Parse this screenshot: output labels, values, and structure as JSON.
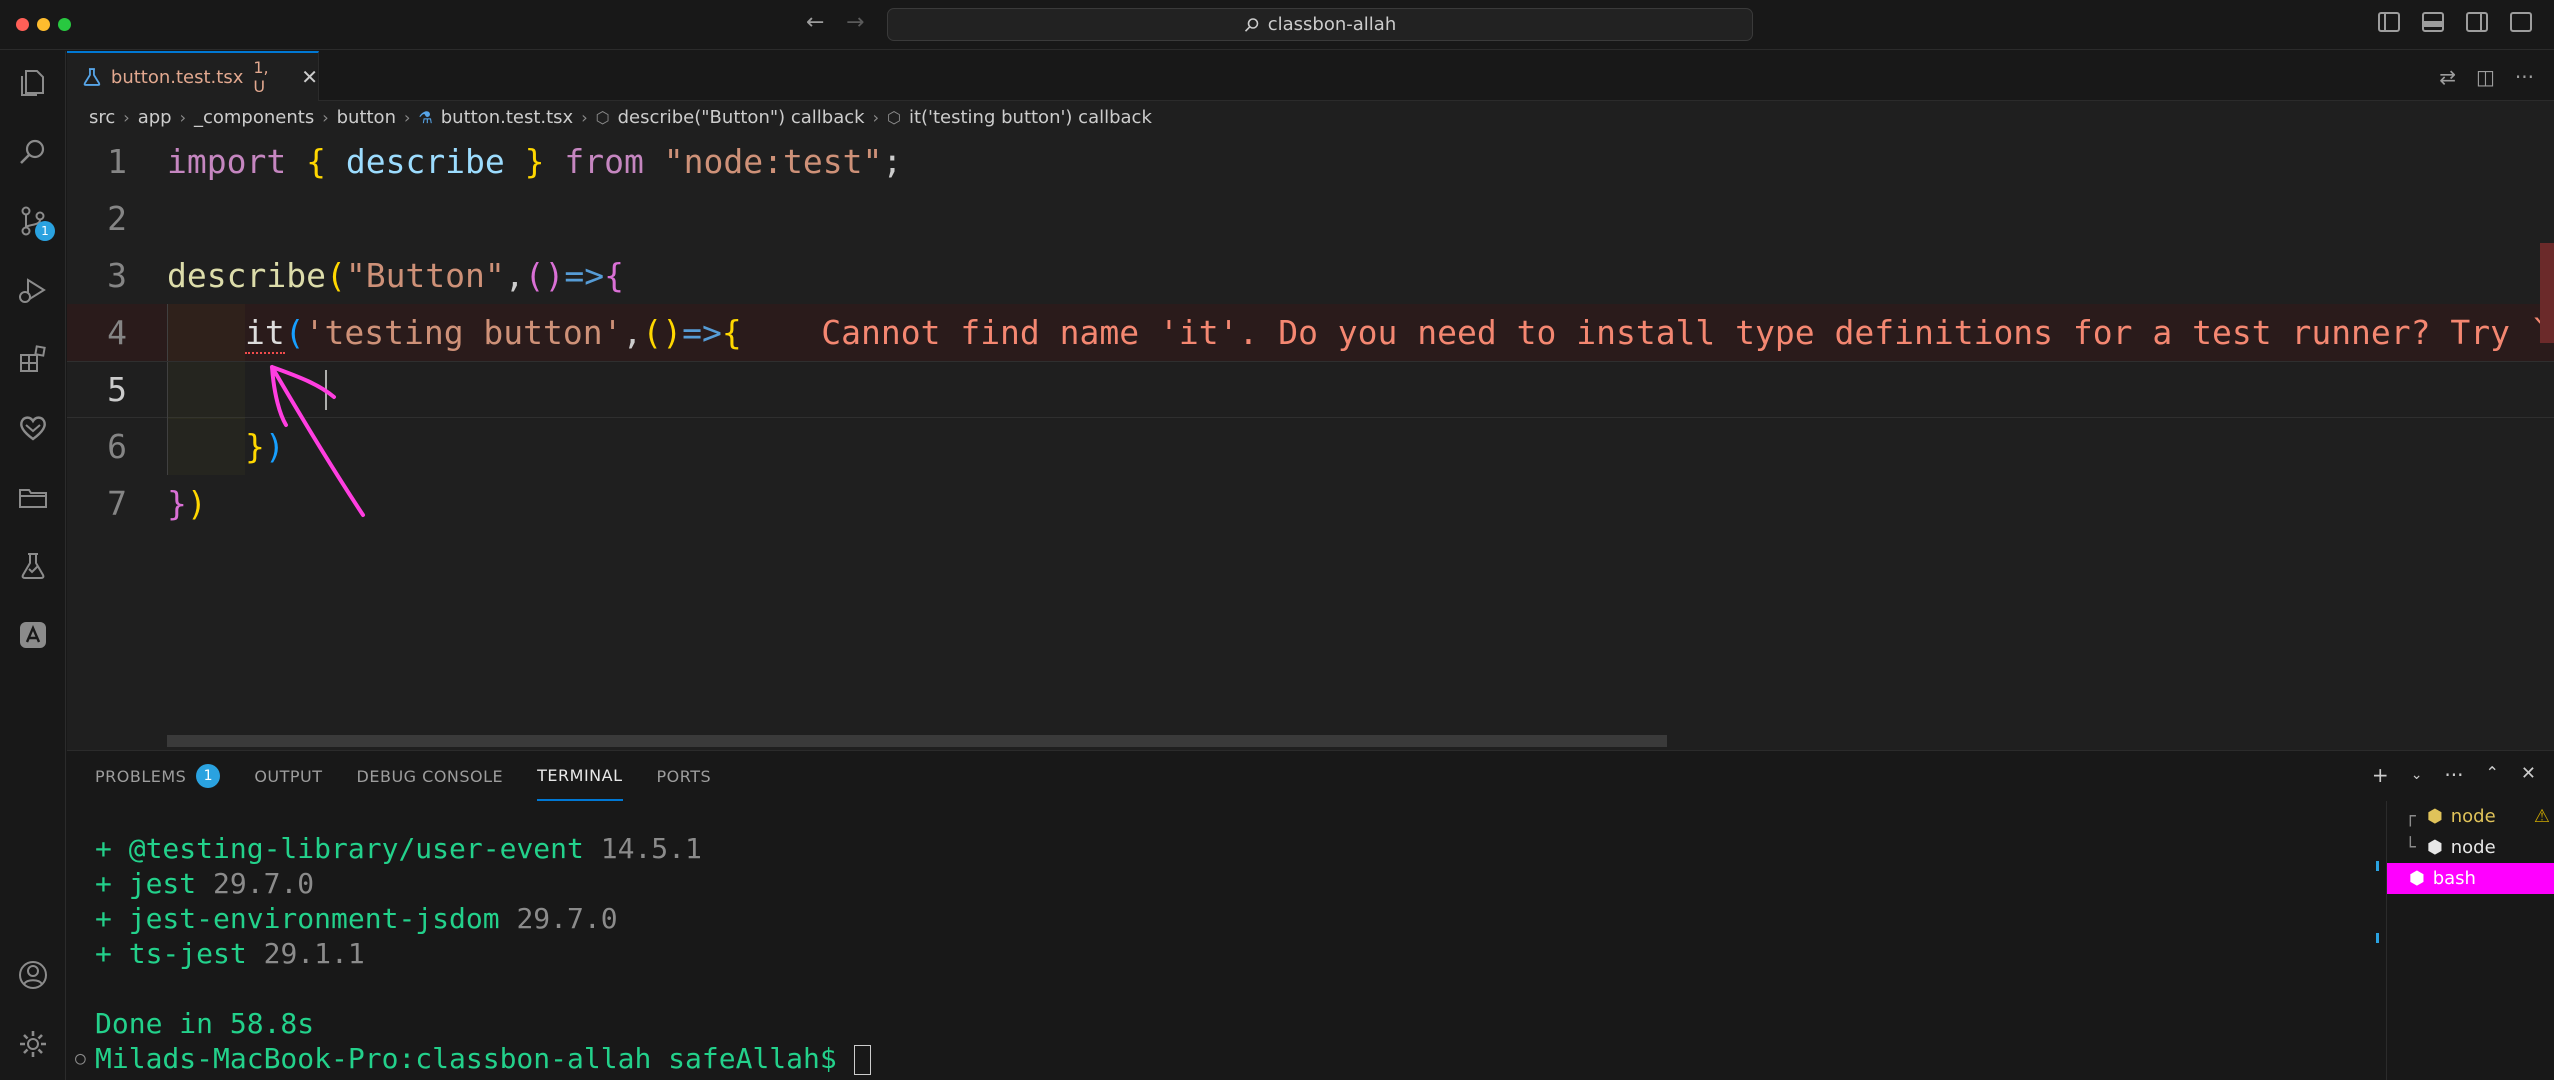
{
  "window": {
    "title": "classbon-allah",
    "traffic_colors": [
      "#ff5f57",
      "#febc2e",
      "#28c840"
    ]
  },
  "activity_bar": {
    "items": [
      {
        "name": "explorer",
        "icon": "files-icon"
      },
      {
        "name": "search",
        "icon": "search-icon"
      },
      {
        "name": "source-control",
        "icon": "source-control-icon",
        "badge": "1"
      },
      {
        "name": "run-debug",
        "icon": "run-debug-icon"
      },
      {
        "name": "extensions",
        "icon": "extensions-icon"
      },
      {
        "name": "favorites",
        "icon": "heart-icon"
      },
      {
        "name": "project-manager",
        "icon": "folders-icon"
      },
      {
        "name": "test",
        "icon": "flask-icon"
      },
      {
        "name": "extension-custom",
        "icon": "a-logo-icon"
      }
    ],
    "bottom": [
      {
        "name": "accounts",
        "icon": "account-icon"
      },
      {
        "name": "manage",
        "icon": "gear-icon"
      }
    ]
  },
  "tab": {
    "label": "button.test.tsx",
    "status": "1, U",
    "close": "✕"
  },
  "breadcrumb": {
    "items": [
      "src",
      "app",
      "_components",
      "button",
      "button.test.tsx",
      "describe(\"Button\") callback",
      "it('testing button') callback"
    ]
  },
  "editor": {
    "line_numbers": [
      "1",
      "2",
      "3",
      "4",
      "5",
      "6",
      "7"
    ],
    "line1": {
      "import": "import",
      "ob": "{",
      "describe": "describe",
      "cb": "}",
      "from": "from",
      "module": "\"node:test\"",
      "semi": ";"
    },
    "line3": {
      "fn": "describe",
      "po": "(",
      "str": "\"Button\"",
      "comma": ",",
      "ao": "(",
      "ac": ")",
      "arrow": "=>",
      "bo": "{"
    },
    "line4": {
      "fn": "it",
      "po": "(",
      "str": "'testing button'",
      "comma": ",",
      "ao": "(",
      "ac": ")",
      "arrow": "=>",
      "bo": "{"
    },
    "line6": {
      "bc": "}",
      "pc": ")"
    },
    "line7": {
      "bc": "}",
      "pc": ")"
    },
    "inline_error": "Cannot find name 'it'. Do you need to install type definitions for a test runner? Try `"
  },
  "panel": {
    "tabs": [
      {
        "label": "PROBLEMS",
        "badge": "1"
      },
      {
        "label": "OUTPUT"
      },
      {
        "label": "DEBUG CONSOLE"
      },
      {
        "label": "TERMINAL"
      },
      {
        "label": "PORTS"
      }
    ],
    "terminal": {
      "packages": [
        {
          "plus": "+",
          "name": "@testing-library/user-event",
          "version": "14.5.1"
        },
        {
          "plus": "+",
          "name": "jest",
          "version": "29.7.0"
        },
        {
          "plus": "+",
          "name": "jest-environment-jsdom",
          "version": "29.7.0"
        },
        {
          "plus": "+",
          "name": "ts-jest",
          "version": "29.1.1"
        }
      ],
      "done": "Done in 58.8s",
      "prompt": "Milads-MacBook-Pro:classbon-allah safeAllah$"
    },
    "terminal_list": [
      {
        "label": "node",
        "tree": "┌",
        "warning": "⚠"
      },
      {
        "label": "node",
        "tree": "└"
      },
      {
        "label": "bash",
        "active": true
      }
    ]
  },
  "colors": {
    "accent": "#0078d4",
    "error": "#f48771",
    "annotation": "#ff3ee0",
    "bash_highlight": "#ff00ff"
  }
}
